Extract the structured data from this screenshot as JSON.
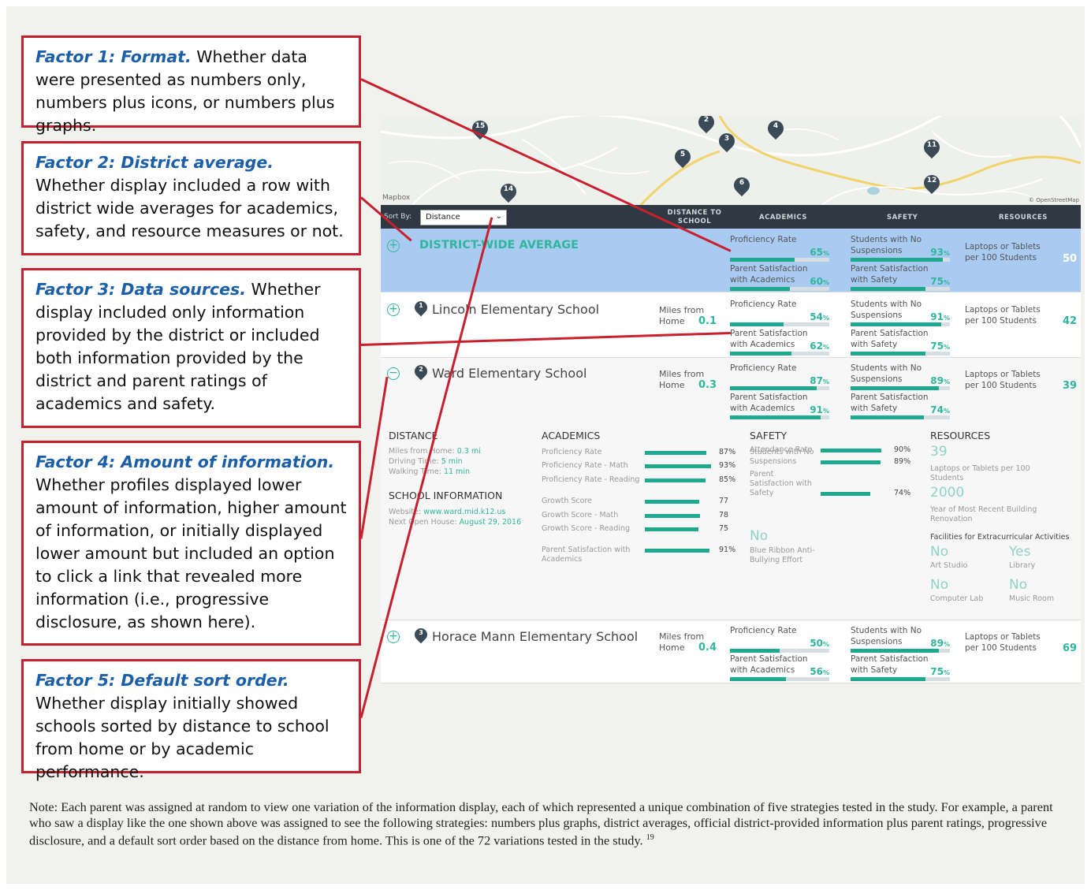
{
  "factors": [
    {
      "title": "Factor 1: Format.",
      "text": " Whether data were presented as numbers only, numbers plus icons, or numbers plus graphs."
    },
    {
      "title": "Factor 2: District average.",
      "text": " Whether display included a row with district wide averages for academics, safety, and resource measures or not."
    },
    {
      "title": "Factor 3: Data sources.",
      "text": " Whether display included only information provided by the district or included both information provided by the district and parent ratings of academics and safety."
    },
    {
      "title": "Factor 4: Amount of information.",
      "text": " Whether profiles displayed lower amount of information, higher amount of information, or initially displayed lower amount but included an option to click a link that revealed more information (i.e., progressive disclosure, as shown here)."
    },
    {
      "title": "Factor 5: Default sort order.",
      "text": " Whether display initially showed schools sorted by distance to school from home or by academic performance."
    }
  ],
  "map": {
    "attribution_left": "Mapbox",
    "attribution_right": "© OpenStreetMap",
    "pins": [
      "15",
      "2",
      "4",
      "3",
      "5",
      "11",
      "6",
      "12",
      "14"
    ]
  },
  "sortbar": {
    "label": "Sort By:",
    "selected": "Distance",
    "col_distance": "DISTANCE TO SCHOOL",
    "col_academics": "ACADEMICS",
    "col_safety": "SAFETY",
    "col_resources": "RESOURCES"
  },
  "district": {
    "name": "DISTRICT-WIDE AVERAGE",
    "prof_label": "Proficiency Rate",
    "prof": "65",
    "prof_fill": 0.65,
    "psa_label": "Parent Satisfaction with Academics",
    "psa": "60",
    "psa_fill": 0.6,
    "sns_label": "Students with No Suspensions",
    "sns": "93",
    "sns_fill": 0.93,
    "pss_label": "Parent Satisfaction with Safety",
    "pss": "75",
    "pss_fill": 0.75,
    "res_label": "Laptops or Tablets per 100 Students",
    "res": "50"
  },
  "schools": [
    {
      "num": "1",
      "name": "Lincoln Elementary School",
      "miles_label": "Miles from Home",
      "miles": "0.1",
      "prof_label": "Proficiency Rate",
      "prof": "54",
      "prof_fill": 0.54,
      "psa_label": "Parent Satisfaction with Academics",
      "psa": "62",
      "psa_fill": 0.62,
      "sns_label": "Students with No Suspensions",
      "sns": "91",
      "sns_fill": 0.91,
      "pss_label": "Parent Satisfaction with Safety",
      "pss": "75",
      "pss_fill": 0.75,
      "res_label": "Laptops or Tablets per 100 Students",
      "res": "42"
    },
    {
      "num": "2",
      "name": "Ward Elementary School",
      "miles_label": "Miles from Home",
      "miles": "0.3",
      "prof_label": "Proficiency Rate",
      "prof": "87",
      "prof_fill": 0.87,
      "psa_label": "Parent Satisfaction with Academics",
      "psa": "91",
      "psa_fill": 0.91,
      "sns_label": "Students with No Suspensions",
      "sns": "89",
      "sns_fill": 0.89,
      "pss_label": "Parent Satisfaction with Safety",
      "pss": "74",
      "pss_fill": 0.74,
      "res_label": "Laptops or Tablets per 100 Students",
      "res": "39"
    },
    {
      "num": "3",
      "name": "Horace Mann Elementary School",
      "miles_label": "Miles from Home",
      "miles": "0.4",
      "prof_label": "Proficiency Rate",
      "prof": "50",
      "prof_fill": 0.5,
      "psa_label": "Parent Satisfaction with Academics",
      "psa": "56",
      "psa_fill": 0.56,
      "sns_label": "Students with No Suspensions",
      "sns": "89",
      "sns_fill": 0.89,
      "pss_label": "Parent Satisfaction with Safety",
      "pss": "75",
      "pss_fill": 0.75,
      "res_label": "Laptops or Tablets per 100 Students",
      "res": "69"
    }
  ],
  "detail": {
    "distance_h": "DISTANCE",
    "miles_line": "Miles from Home:",
    "miles_val": "0.3 mi",
    "drive_line": "Driving Time:",
    "drive_val": "5 min",
    "walk_line": "Walking Time:",
    "walk_val": "11 min",
    "info_h": "SCHOOL INFORMATION",
    "web_line": "Website:",
    "web_val": "www.ward.mid.k12.us",
    "open_line": "Next Open House:",
    "open_val": "August 29, 2016",
    "acad_h": "ACADEMICS",
    "acad": [
      {
        "label": "Proficiency Rate",
        "val": "87%",
        "fill": 0.87
      },
      {
        "label": "Proficiency Rate - Math",
        "val": "93%",
        "fill": 0.93
      },
      {
        "label": "Proficiency Rate - Reading",
        "val": "85%",
        "fill": 0.85
      },
      {
        "label": "Growth Score",
        "val": "77",
        "fill": 0.77
      },
      {
        "label": "Growth Score - Math",
        "val": "78",
        "fill": 0.78
      },
      {
        "label": "Growth Score - Reading",
        "val": "75",
        "fill": 0.75
      },
      {
        "label": "Parent Satisfaction with Academics",
        "val": "91%",
        "fill": 0.91
      }
    ],
    "safety_h": "SAFETY",
    "safety": [
      {
        "label": "Students with No Suspensions",
        "val": "89%",
        "fill": 0.89
      },
      {
        "label": "Attendance Rate",
        "val": "90%",
        "fill": 0.9
      },
      {
        "label": "Parent Satisfaction with Safety",
        "val": "74%",
        "fill": 0.74
      }
    ],
    "ribbon_val": "No",
    "ribbon_label": "Blue Ribbon Anti-Bullying Effort",
    "res_h": "RESOURCES",
    "laptops_val": "39",
    "laptops_label": "Laptops or Tablets per 100 Students",
    "year_val": "2000",
    "year_label": "Year of Most Recent Building Renovation",
    "fac_h": "Facilities for Extracurricular Activities",
    "fac": [
      {
        "val": "No",
        "label": "Art Studio"
      },
      {
        "val": "Yes",
        "label": "Library"
      },
      {
        "val": "No",
        "label": "Computer Lab"
      },
      {
        "val": "No",
        "label": "Music Room"
      }
    ]
  },
  "note": "Note: Each parent was assigned at random to view one variation of the information display, each of which represented a unique combination of five strategies tested in the study. For example, a parent who saw a display like the one shown above was assigned to see the following strategies: numbers plus graphs, district averages, official district-provided information plus parent ratings, progressive disclosure, and a default sort order based on the distance from home. This is one of the 72 variations tested in the study.",
  "note_ref": "19"
}
